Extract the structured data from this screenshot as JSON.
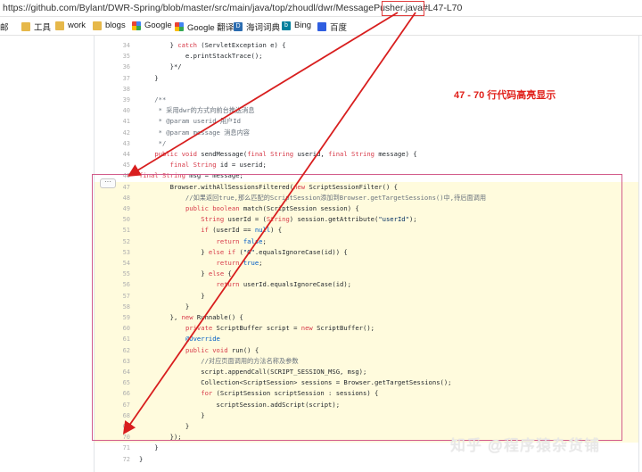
{
  "browser": {
    "url_prefix": "https://github.com/Bylant/DWR-Spring/blob/master/src/main/java/top/zhoudl/dwr/MessagePusher.java",
    "url_hash": "#L47-L70"
  },
  "bookmarks": [
    {
      "label": "邮",
      "icon": "folder-icon"
    },
    {
      "label": "工具",
      "icon": "folder-icon"
    },
    {
      "label": "work",
      "icon": "folder-icon"
    },
    {
      "label": "blogs",
      "icon": "folder-icon"
    },
    {
      "label": "Google",
      "icon": "google-icon"
    },
    {
      "label": "Google 翻译",
      "icon": "google-icon"
    },
    {
      "label": "海词词典",
      "icon": "dict-icon"
    },
    {
      "label": "Bing",
      "icon": "bing-icon"
    },
    {
      "label": "百度",
      "icon": "baidu-icon"
    }
  ],
  "annotation": "47 - 70 行代码高亮显示",
  "watermark": "知乎 @程序猿杂货铺",
  "code_lines": [
    {
      "num": "34",
      "text": "        } catch (ServletException e) {"
    },
    {
      "num": "35",
      "text": "            e.printStackTrace();"
    },
    {
      "num": "36",
      "text": "        }*/"
    },
    {
      "num": "37",
      "text": "    }"
    },
    {
      "num": "38",
      "text": ""
    },
    {
      "num": "39",
      "text": "    /**"
    },
    {
      "num": "40",
      "text": "     * 采用dwr的方式向前台推送消息"
    },
    {
      "num": "41",
      "text": "     * @param userid 用户Id"
    },
    {
      "num": "42",
      "text": "     * @param message 消息内容"
    },
    {
      "num": "43",
      "text": "     */"
    },
    {
      "num": "44",
      "text": "    public void sendMessage(final String userid, final String message) {"
    },
    {
      "num": "45",
      "text": "        final String id = userid;"
    },
    {
      "num": "46",
      "text": "final String msg = message;"
    },
    {
      "num": "47",
      "text": "        Browser.withAllSessionsFiltered(new ScriptSessionFilter() {"
    },
    {
      "num": "48",
      "text": "            //如果返回true,那么匹配的ScriptSession添加到Browser.getTargetSessions()中,待后面调用"
    },
    {
      "num": "49",
      "text": "            public boolean match(ScriptSession session) {"
    },
    {
      "num": "50",
      "text": "                String userId = (String) session.getAttribute(\"userId\");"
    },
    {
      "num": "51",
      "text": "                if (userId == null) {"
    },
    {
      "num": "52",
      "text": "                    return false;"
    },
    {
      "num": "53",
      "text": "                } else if (\"0\".equalsIgnoreCase(id)) {"
    },
    {
      "num": "54",
      "text": "                    return true;"
    },
    {
      "num": "55",
      "text": "                } else {"
    },
    {
      "num": "56",
      "text": "                    return userId.equalsIgnoreCase(id);"
    },
    {
      "num": "57",
      "text": "                }"
    },
    {
      "num": "58",
      "text": "            }"
    },
    {
      "num": "59",
      "text": "        }, new Runnable() {"
    },
    {
      "num": "60",
      "text": "            private ScriptBuffer script = new ScriptBuffer();"
    },
    {
      "num": "61",
      "text": "            @Override"
    },
    {
      "num": "62",
      "text": "            public void run() {"
    },
    {
      "num": "63",
      "text": "                //对应页面调用的方法名称及参数"
    },
    {
      "num": "64",
      "text": "                script.appendCall(SCRIPT_SESSION_MSG, msg);"
    },
    {
      "num": "65",
      "text": "                Collection<ScriptSession> sessions = Browser.getTargetSessions();"
    },
    {
      "num": "66",
      "text": "                for (ScriptSession scriptSession : sessions) {"
    },
    {
      "num": "67",
      "text": "                    scriptSession.addScript(script);"
    },
    {
      "num": "68",
      "text": "                }"
    },
    {
      "num": "69",
      "text": "            }"
    },
    {
      "num": "70",
      "text": "        });"
    },
    {
      "num": "71",
      "text": "    }"
    },
    {
      "num": "72",
      "text": "}"
    }
  ],
  "highlight_range": [
    47,
    70
  ],
  "colors": {
    "annotation": "#e0201a",
    "highlight": "#fffbdd",
    "selection_box": "#d25c8b"
  }
}
